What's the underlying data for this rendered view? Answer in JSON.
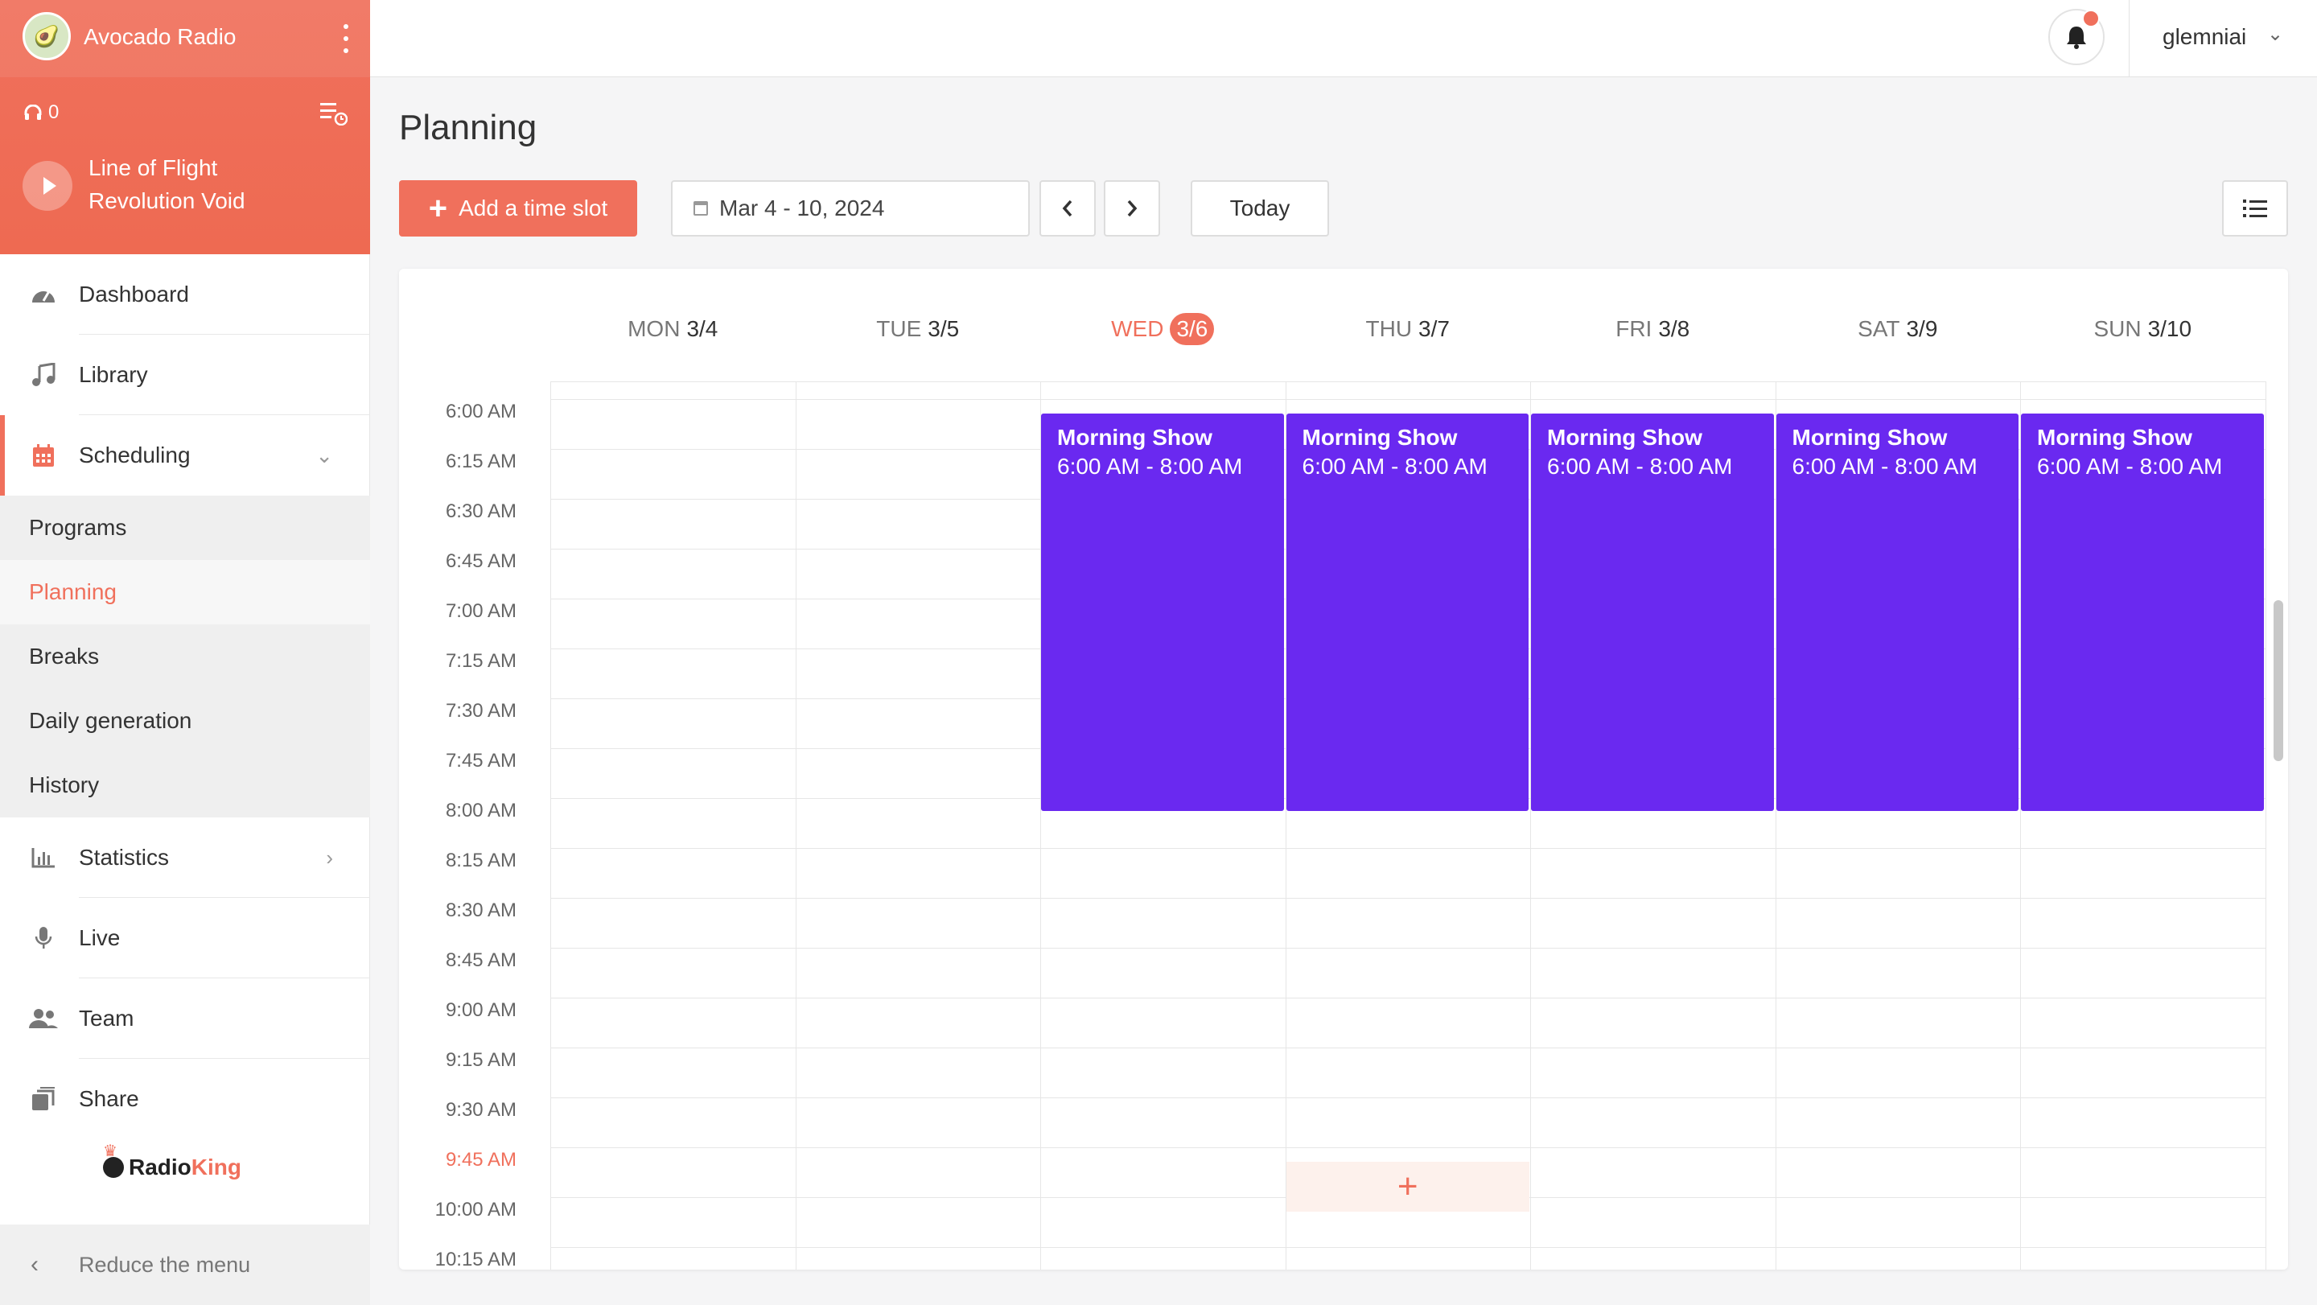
{
  "sidebar": {
    "station_name": "Avocado Radio",
    "listeners": "0",
    "now_playing": {
      "title": "Line of Flight",
      "artist": "Revolution Void"
    },
    "nav": [
      {
        "label": "Dashboard",
        "icon": "gauge-icon"
      },
      {
        "label": "Library",
        "icon": "music-note-icon"
      },
      {
        "label": "Scheduling",
        "icon": "calendar-icon"
      },
      {
        "label": "Statistics",
        "icon": "bar-chart-icon"
      },
      {
        "label": "Live",
        "icon": "microphone-icon"
      },
      {
        "label": "Team",
        "icon": "users-icon"
      },
      {
        "label": "Share",
        "icon": "share-icon"
      }
    ],
    "submenu": [
      "Programs",
      "Planning",
      "Breaks",
      "Daily generation",
      "History"
    ],
    "brand": {
      "radio": "Radio",
      "king": "King"
    },
    "reduce_label": "Reduce the menu"
  },
  "topbar": {
    "username": "glemniai"
  },
  "main": {
    "title": "Planning",
    "add_label": "Add a time slot",
    "date_range": "Mar 4 - 10, 2024",
    "today_label": "Today"
  },
  "calendar": {
    "days": [
      {
        "dow": "MON",
        "date": "3/4",
        "today": false
      },
      {
        "dow": "TUE",
        "date": "3/5",
        "today": false
      },
      {
        "dow": "WED",
        "date": "3/6",
        "today": true
      },
      {
        "dow": "THU",
        "date": "3/7",
        "today": false
      },
      {
        "dow": "FRI",
        "date": "3/8",
        "today": false
      },
      {
        "dow": "SAT",
        "date": "3/9",
        "today": false
      },
      {
        "dow": "SUN",
        "date": "3/10",
        "today": false
      }
    ],
    "times": [
      "6:00 AM",
      "6:15 AM",
      "6:30 AM",
      "6:45 AM",
      "7:00 AM",
      "7:15 AM",
      "7:30 AM",
      "7:45 AM",
      "8:00 AM",
      "8:15 AM",
      "8:30 AM",
      "8:45 AM",
      "9:00 AM",
      "9:15 AM",
      "9:30 AM",
      "9:45 AM",
      "10:00 AM",
      "10:15 AM"
    ],
    "current_time": "9:45 AM",
    "events": [
      {
        "day": 2,
        "title": "Morning Show",
        "time": "6:00 AM - 8:00 AM",
        "start_slot": 0,
        "slots": 8
      },
      {
        "day": 3,
        "title": "Morning Show",
        "time": "6:00 AM - 8:00 AM",
        "start_slot": 0,
        "slots": 8
      },
      {
        "day": 4,
        "title": "Morning Show",
        "time": "6:00 AM - 8:00 AM",
        "start_slot": 0,
        "slots": 8
      },
      {
        "day": 5,
        "title": "Morning Show",
        "time": "6:00 AM - 8:00 AM",
        "start_slot": 0,
        "slots": 8
      },
      {
        "day": 6,
        "title": "Morning Show",
        "time": "6:00 AM - 8:00 AM",
        "start_slot": 0,
        "slots": 8
      }
    ],
    "hover_slot": {
      "day": 3,
      "slot": 15
    }
  },
  "colors": {
    "accent": "#f0705c",
    "event": "#6a29f0"
  }
}
